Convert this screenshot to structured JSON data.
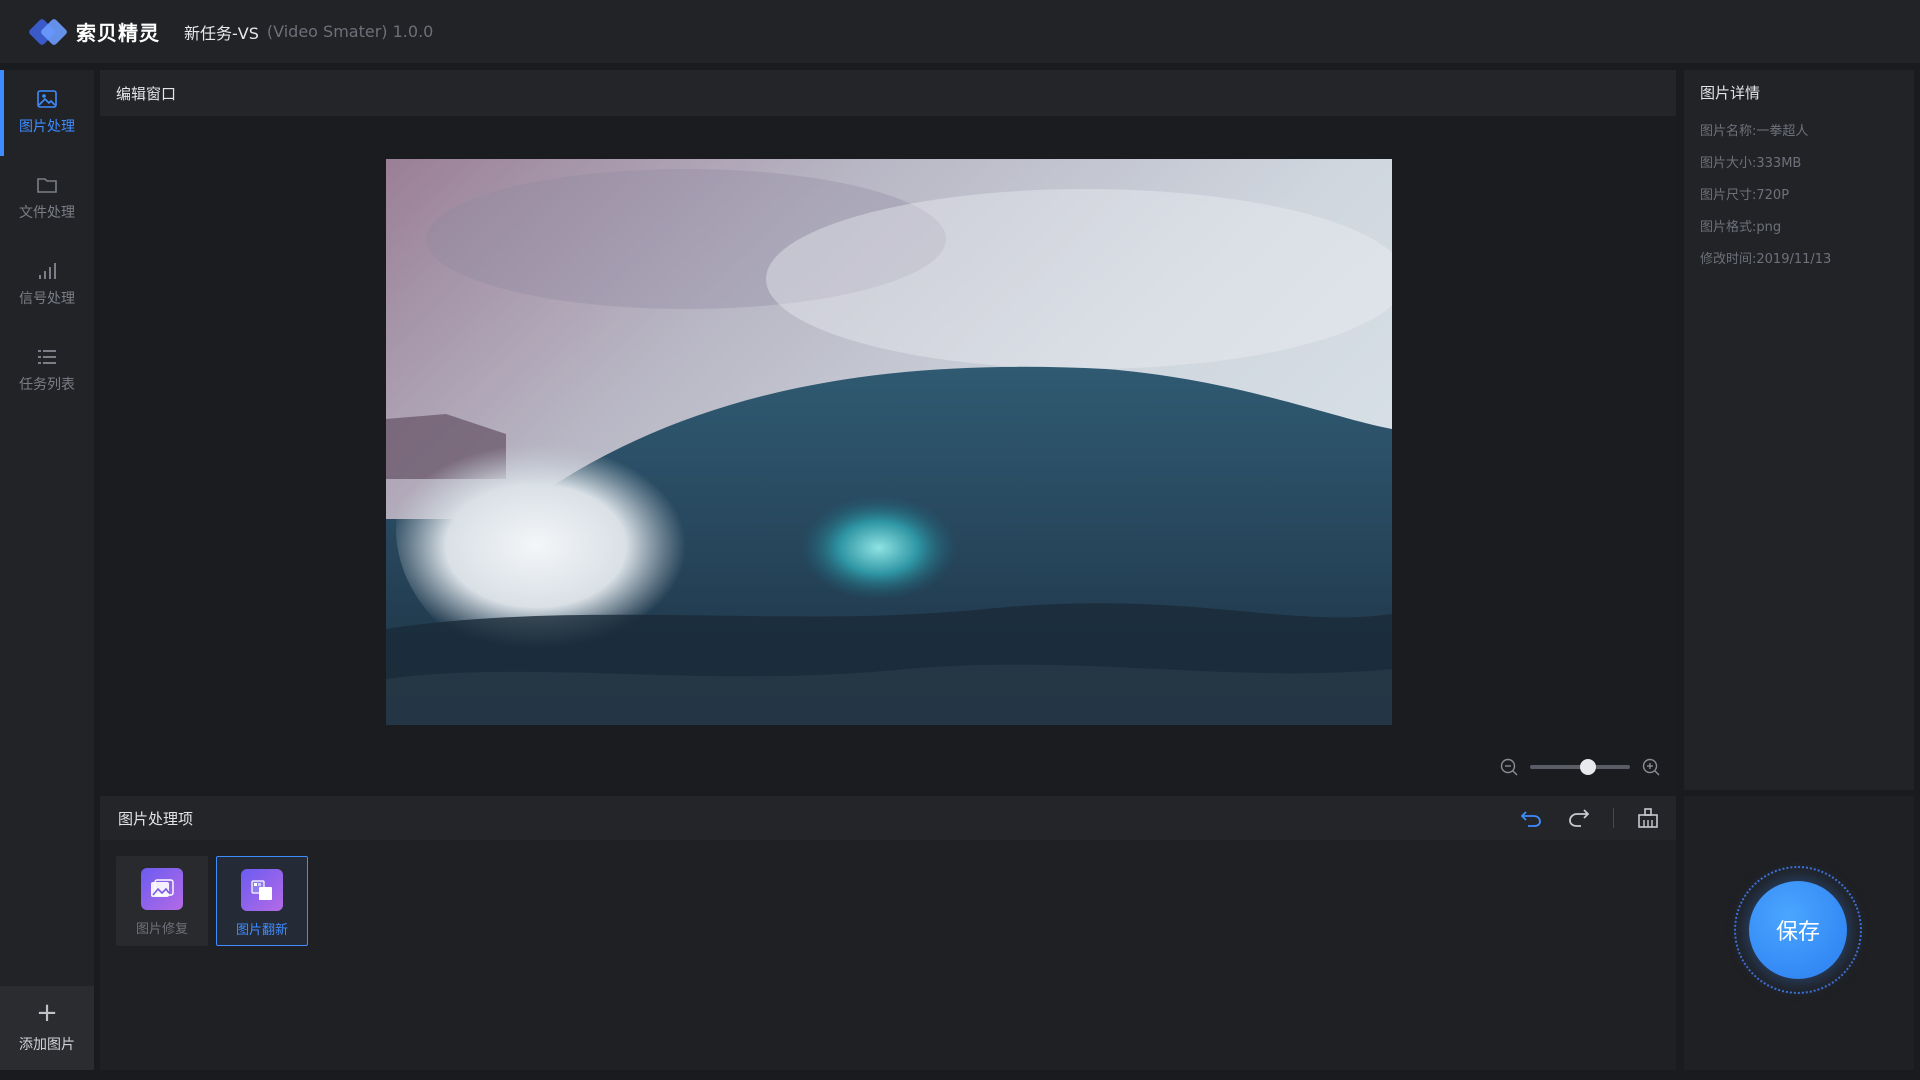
{
  "app": {
    "brand_name": "索贝精灵",
    "task_title": "新任务-VS",
    "task_subtitle": "(Video Smater) 1.0.0"
  },
  "sidebar": {
    "items": [
      {
        "label": "图片处理",
        "icon": "image-icon",
        "active": true
      },
      {
        "label": "文件处理",
        "icon": "folder-icon",
        "active": false
      },
      {
        "label": "信号处理",
        "icon": "signal-icon",
        "active": false
      },
      {
        "label": "任务列表",
        "icon": "list-icon",
        "active": false
      }
    ],
    "add_label": "添加图片"
  },
  "editor": {
    "title": "编辑窗口",
    "zoom_level": 0.58
  },
  "details": {
    "title": "图片详情",
    "rows": [
      {
        "key": "图片名称:",
        "value": "一拳超人"
      },
      {
        "key": "图片大小:",
        "value": "333MB"
      },
      {
        "key": "图片尺寸:",
        "value": "720P"
      },
      {
        "key": "图片格式:",
        "value": "png"
      },
      {
        "key": "修改时间:",
        "value": "2019/11/13"
      }
    ]
  },
  "operations": {
    "title": "图片处理项",
    "items": [
      {
        "label": "图片修复",
        "selected": false
      },
      {
        "label": "图片翻新",
        "selected": true
      }
    ]
  },
  "save": {
    "label": "保存"
  },
  "colors": {
    "accent": "#3f8cff",
    "background": "#1a1b1e",
    "panel": "#222326"
  }
}
